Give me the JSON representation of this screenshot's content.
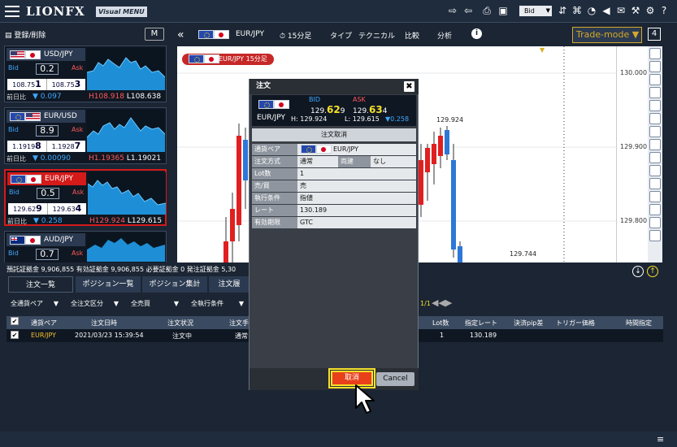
{
  "app": {
    "logo": "LIONFX",
    "badge": "Visual MENU",
    "bid_select": "Bid"
  },
  "sidebar": {
    "add_label": "登録/削除",
    "m_label": "M",
    "cards": [
      {
        "pair": "USD/JPY",
        "bid_lbl": "Bid",
        "ask_lbl": "Ask",
        "spread": "0.2",
        "bid_a": "108.75",
        "bid_b": "1",
        "ask_a": "108.75",
        "ask_b": "3",
        "prev_lbl": "前日比",
        "prev": "▼ 0.097",
        "high": "H108.918",
        "low": "L108.638"
      },
      {
        "pair": "EUR/USD",
        "bid_lbl": "Bid",
        "ask_lbl": "Ask",
        "spread": "8.9",
        "bid_a": "1.1919",
        "bid_b": "8",
        "ask_a": "1.1928",
        "ask_b": "7",
        "prev_lbl": "前日比",
        "prev": "▼ 0.00090",
        "high": "H1.19365",
        "low": "L1.19021"
      },
      {
        "pair": "EUR/JPY",
        "bid_lbl": "Bid",
        "ask_lbl": "Ask",
        "spread": "0.5",
        "bid_a": "129.62",
        "bid_b": "9",
        "ask_a": "129.63",
        "ask_b": "4",
        "prev_lbl": "前日比",
        "prev": "▼ 0.258",
        "high": "H129.924",
        "low": "L129.615"
      },
      {
        "pair": "AUD/JPY",
        "bid_lbl": "Bid",
        "ask_lbl": "Ask",
        "spread": "0.7"
      }
    ]
  },
  "chart_toolbar": {
    "pair": "EUR/JPY",
    "interval": "15分足",
    "type": "タイプ",
    "technical": "テクニカル",
    "compare": "比較",
    "analysis": "分析",
    "trade_mode": "Trade-mode ▼",
    "layout": "4"
  },
  "chart": {
    "label": "EUR/JPY 15分足",
    "prices": [
      "130.000",
      "129.900",
      "129.800"
    ],
    "annotations": [
      "129.924",
      "129.744"
    ]
  },
  "balance": "預託証拠金 9,906,855  有効証拠金 9,906,855  必要証拠金 0  発注証拠金 5,30",
  "tabs": [
    "注文一覧",
    "ポジション一覧",
    "ポジション集計",
    "注文履"
  ],
  "filters": [
    "全通貨ペア",
    "全注文区分",
    "全売買",
    "全執行条件"
  ],
  "pagination": "1/1",
  "table": {
    "headers": [
      "通貨ペア",
      "注文日時",
      "注文状況",
      "注文手",
      "Lot数",
      "指定レート",
      "決済pip差",
      "トリガー価格",
      "時間指定"
    ],
    "rows": [
      {
        "pair": "EUR/JPY",
        "datetime": "2021/03/23 15:39:54",
        "status": "注文中",
        "method": "通常",
        "lot": "1",
        "rate": "130.189"
      }
    ]
  },
  "modal": {
    "title": "注文",
    "pair": "EUR/JPY",
    "bid_lbl": "BID",
    "ask_lbl": "ASK",
    "bid_a": "129.",
    "bid_b": "62",
    "bid_c": "9",
    "ask_a": "129.",
    "ask_b": "63",
    "ask_c": "4",
    "high": "H: 129.924",
    "low": "L: 129.615",
    "change": "▼0.258",
    "subtitle": "注文取消",
    "rows": [
      {
        "k": "通貨ペア",
        "v": "EUR/JPY"
      },
      {
        "k": "注文方式",
        "v": "通常",
        "k2": "両建",
        "v2": "なし"
      },
      {
        "k": "Lot数",
        "v": "1"
      },
      {
        "k": "売/買",
        "v": "売"
      },
      {
        "k": "執行条件",
        "v": "指値"
      },
      {
        "k": "レート",
        "v": "130.189"
      },
      {
        "k": "有効期限",
        "v": "GTC"
      }
    ],
    "cancel_label": "取消",
    "close_label": "Cancel"
  }
}
